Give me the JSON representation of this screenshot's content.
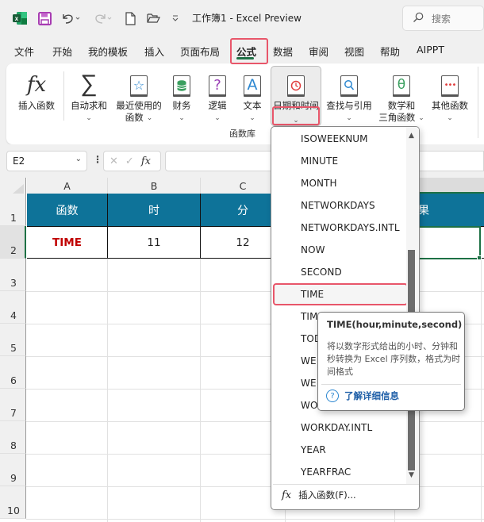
{
  "titlebar": {
    "title": "工作簿1  -  Excel Preview",
    "search_placeholder": "搜索",
    "icons": [
      "excel-logo",
      "save",
      "undo",
      "redo",
      "new-file",
      "open-folder",
      "customize-toolbar"
    ]
  },
  "tabs": [
    "文件",
    "开始",
    "我的模板",
    "插入",
    "页面布局",
    "公式",
    "数据",
    "审阅",
    "视图",
    "帮助",
    "AIPPT"
  ],
  "active_tab": "公式",
  "ribbon": {
    "buttons": [
      {
        "id": "insert-function",
        "label": "插入函数",
        "icon": "fx"
      },
      {
        "id": "autosum",
        "label": "自动求和",
        "icon": "sigma",
        "dropdown": true
      },
      {
        "id": "recent",
        "label": "最近使用的\n函数",
        "label1": "最近使用的",
        "label2": "函数",
        "icon": "star-book",
        "dropdown": true
      },
      {
        "id": "financial",
        "label": "财务",
        "icon": "coins-book",
        "dropdown": true
      },
      {
        "id": "logical",
        "label": "逻辑",
        "icon": "question-book",
        "dropdown": true
      },
      {
        "id": "text",
        "label": "文本",
        "icon": "a-book",
        "dropdown": true
      },
      {
        "id": "datetime",
        "label": "日期和时间",
        "icon": "clock-book",
        "dropdown": true
      },
      {
        "id": "lookup",
        "label": "查找与引用",
        "icon": "magnifier-book",
        "dropdown": true
      },
      {
        "id": "math",
        "label1": "数学和",
        "label2": "三角函数",
        "icon": "theta-book",
        "dropdown": true
      },
      {
        "id": "more",
        "label": "其他函数",
        "icon": "dots-book",
        "dropdown": true
      }
    ],
    "group_label": "函数库"
  },
  "formula_bar": {
    "name_box": "E2",
    "formula": ""
  },
  "sheet": {
    "columns": [
      "A",
      "B",
      "C"
    ],
    "rows": [
      "1",
      "2",
      "3",
      "4",
      "5",
      "6",
      "7",
      "8",
      "9",
      "10"
    ],
    "header_row": [
      "函数",
      "时",
      "分",
      "果"
    ],
    "data_row": [
      "TIME",
      "11",
      "12"
    ]
  },
  "dropdown": {
    "items": [
      "ISOWEEKNUM",
      "MINUTE",
      "MONTH",
      "NETWORKDAYS",
      "NETWORKDAYS.INTL",
      "NOW",
      "SECOND",
      "TIME",
      "TIMEVALUE",
      "TODAY",
      "WEEKDAY",
      "WEEKNUM",
      "WORKDAY",
      "WORKDAY.INTL",
      "YEAR",
      "YEARFRAC"
    ],
    "visible_items": [
      "ISOWEEKNUM",
      "MINUTE",
      "MONTH",
      "NETWORKDAYS",
      "NETWORKDAYS.INTL",
      "NOW",
      "SECOND",
      "TIME",
      "TIM",
      "TOD",
      "WE",
      "WE",
      "WO",
      "WORKDAY.INTL",
      "YEAR",
      "YEARFRAC"
    ],
    "highlighted": "TIME",
    "footer": "插入函数(F)..."
  },
  "tooltip": {
    "title": "TIME(hour,minute,second)",
    "description": "将以数字形式给出的小时、分钟和秒转换为 Excel 序列数，格式为时间格式",
    "link": "了解详细信息"
  },
  "colors": {
    "accent_green": "#1e7145",
    "highlight_red": "#e8566a",
    "header_blue": "#0e7399",
    "time_red": "#c00000",
    "link_blue": "#1f5fa8"
  }
}
